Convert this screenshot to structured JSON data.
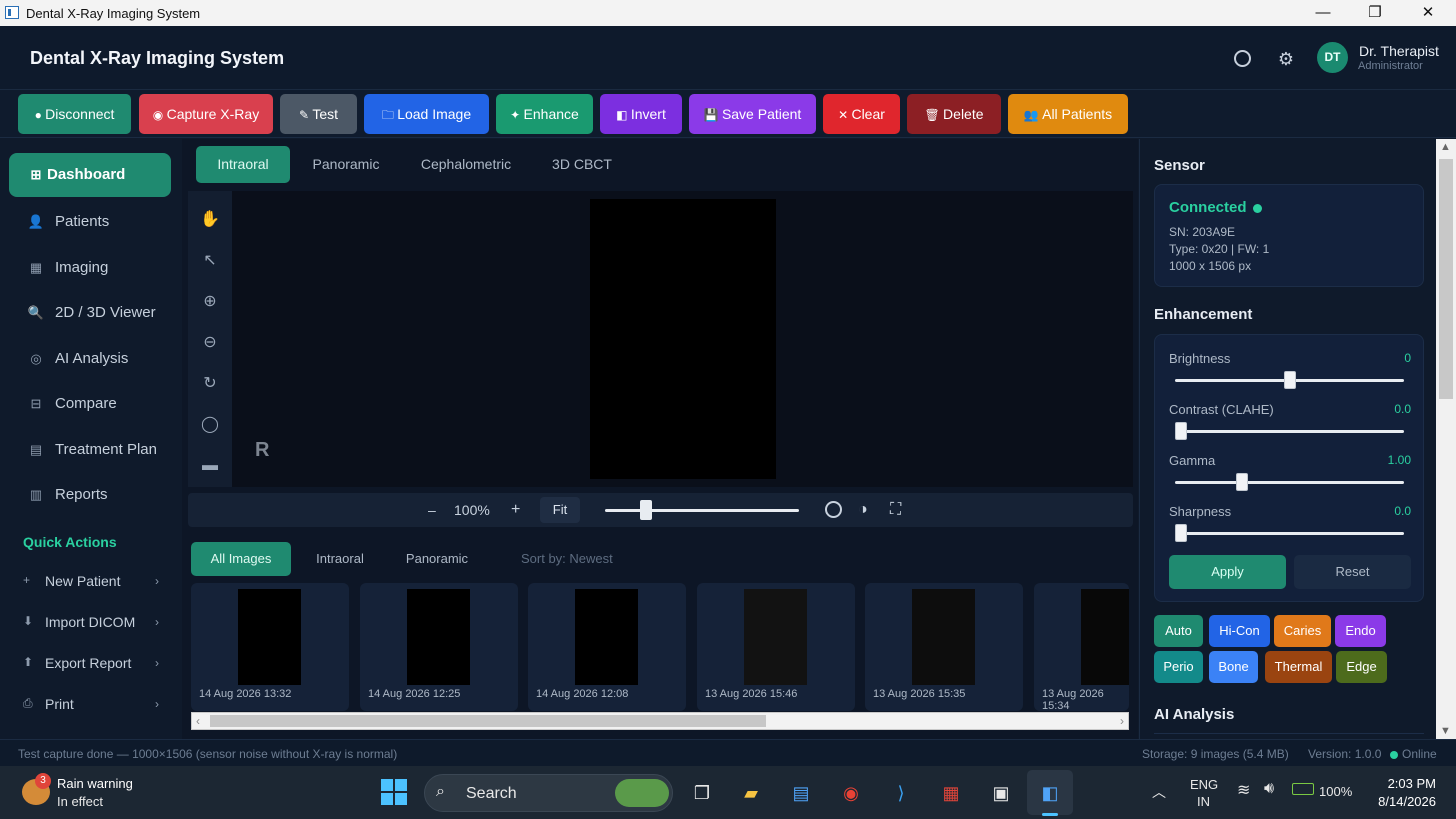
{
  "window": {
    "title": "Dental X-Ray Imaging System",
    "min": "—",
    "max": "❐",
    "close": "✕"
  },
  "header": {
    "title": "Dental X-Ray Imaging System",
    "avatar": "DT",
    "user_name": "Dr. Therapist",
    "user_role": "Administrator"
  },
  "toolbar": [
    {
      "icon": "●",
      "label": "Disconnect",
      "color": "#1f8a70"
    },
    {
      "icon": "◉",
      "label": "Capture X-Ray",
      "color": "#d9404e"
    },
    {
      "icon": "✎",
      "label": "Test",
      "color": "#4c5866"
    },
    {
      "icon": "🗀",
      "label": "Load Image",
      "color": "#2264e6"
    },
    {
      "icon": "✦",
      "label": "Enhance",
      "color": "#1a9a70"
    },
    {
      "icon": "◧",
      "label": "Invert",
      "color": "#7c2fe0"
    },
    {
      "icon": "💾",
      "label": "Save Patient",
      "color": "#8b3ae8"
    },
    {
      "icon": "✕",
      "label": "Clear",
      "color": "#e0262d"
    },
    {
      "icon": "🗑",
      "label": "Delete",
      "color": "#8c1f24"
    },
    {
      "icon": "👥",
      "label": "All Patients",
      "color": "#e08a0f"
    }
  ],
  "sidebar": {
    "items": [
      {
        "icon": "⊞",
        "label": "Dashboard"
      },
      {
        "icon": "👤",
        "label": "Patients"
      },
      {
        "icon": "▦",
        "label": "Imaging"
      },
      {
        "icon": "🔍",
        "label": "2D / 3D Viewer"
      },
      {
        "icon": "◎",
        "label": "AI Analysis"
      },
      {
        "icon": "⊟",
        "label": "Compare"
      },
      {
        "icon": "▤",
        "label": "Treatment Plan"
      },
      {
        "icon": "▥",
        "label": "Reports"
      }
    ],
    "quick_actions_title": "Quick Actions",
    "quick_actions": [
      {
        "icon": "+",
        "label": "New Patient",
        "chev": "›"
      },
      {
        "icon": "⬇",
        "label": "Import DICOM",
        "chev": "›"
      },
      {
        "icon": "⬆",
        "label": "Export Report",
        "chev": "›"
      },
      {
        "icon": "⎙",
        "label": "Print",
        "chev": "›"
      }
    ]
  },
  "viewer": {
    "tabs": [
      "Intraoral",
      "Panoramic",
      "Cephalometric",
      "3D CBCT"
    ],
    "side_marker": "R",
    "zoom": {
      "minus": "–",
      "value": "100%",
      "plus": "+",
      "fit": "Fit",
      "level": 0.19
    }
  },
  "gallery": {
    "tabs": [
      "All Images",
      "Intraoral",
      "Panoramic"
    ],
    "sort": "Sort by: Newest",
    "items": [
      {
        "date": "14 Aug 2026 13:32",
        "tone": "#000000"
      },
      {
        "date": "14 Aug 2026 12:25",
        "tone": "#000000"
      },
      {
        "date": "14 Aug 2026 12:08",
        "tone": "#000000"
      },
      {
        "date": "13 Aug 2026 15:46",
        "tone": "#121212"
      },
      {
        "date": "13 Aug 2026 15:35",
        "tone": "#0d0d0d"
      },
      {
        "date": "13 Aug 2026 15:34",
        "tone": "#080808"
      }
    ],
    "scroll": {
      "left": "‹",
      "right": "›"
    }
  },
  "sensor": {
    "title": "Sensor",
    "status": "Connected",
    "serial": "SN: 203A9E",
    "type": "Type: 0x20 | FW: 1",
    "resolution": "1000 x 1506 px"
  },
  "enhancement": {
    "title": "Enhancement",
    "sliders": [
      {
        "label": "Brightness",
        "value": "0",
        "pos": 0.5
      },
      {
        "label": "Contrast (CLAHE)",
        "value": "0.0",
        "pos": 0.0
      },
      {
        "label": "Gamma",
        "value": "1.00",
        "pos": 0.28
      },
      {
        "label": "Sharpness",
        "value": "0.0",
        "pos": 0.0
      }
    ],
    "apply": "Apply",
    "reset": "Reset",
    "presets": [
      {
        "label": "Auto",
        "color": "#1f8a70"
      },
      {
        "label": "Hi-Con",
        "color": "#2264e6"
      },
      {
        "label": "Caries",
        "color": "#e0791a"
      },
      {
        "label": "Endo",
        "color": "#8b3ae8"
      },
      {
        "label": "Perio",
        "color": "#138a8a"
      },
      {
        "label": "Bone",
        "color": "#3b82f6"
      },
      {
        "label": "Thermal",
        "color": "#9a4410"
      },
      {
        "label": "Edge",
        "color": "#4d6b1c"
      }
    ]
  },
  "ai": {
    "title": "AI Analysis"
  },
  "status": {
    "message": "Test capture done — 1000×1506 (sensor noise without X-ray is normal)",
    "storage": "Storage: 9 images (5.4 MB)",
    "version": "Version: 1.0.0",
    "online": "Online"
  },
  "taskbar": {
    "weather_badge": "3",
    "weather_line1": "Rain warning",
    "weather_line2": "In effect",
    "search": "Search",
    "lang1": "ENG",
    "lang2": "IN",
    "battery": "100%",
    "time": "2:03 PM",
    "date": "8/14/2026"
  }
}
